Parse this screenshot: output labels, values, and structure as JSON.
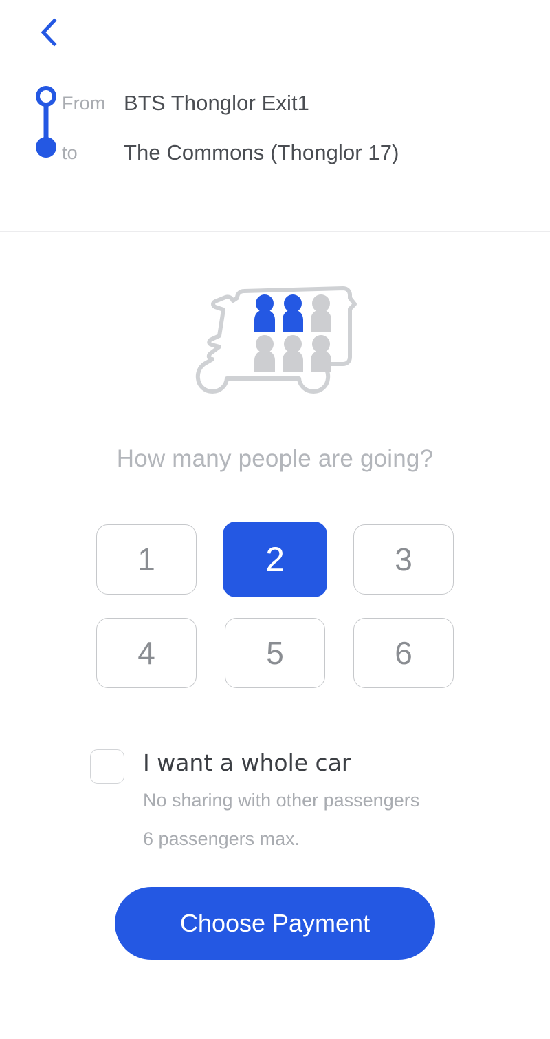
{
  "header": {
    "back_icon": "chevron-left-icon"
  },
  "route": {
    "from_label": "From",
    "from_value": "BTS Thonglor Exit1",
    "to_label": "to",
    "to_value": "The Commons (Thonglor 17)",
    "origin_icon": "circle-outline-icon",
    "destination_icon": "circle-filled-icon"
  },
  "illustration": {
    "name": "van-seating-icon",
    "total_seats": 6,
    "filled_seats": 2,
    "rows": 2,
    "columns": 3
  },
  "question": "How many people are going?",
  "numpad": {
    "selected": "2",
    "rows": [
      [
        "1",
        "2",
        "3"
      ],
      [
        "4",
        "5",
        "6"
      ]
    ]
  },
  "whole_car": {
    "checked": false,
    "title": "I want a whole car",
    "subtitle": "No sharing with other passengers",
    "subtitle2": "6 passengers max."
  },
  "cta": {
    "label": "Choose Payment"
  },
  "colors": {
    "accent": "#2458e3",
    "muted_text": "#a9acb1",
    "value_text": "#4a4d52",
    "border": "#c6c8cb",
    "seat_gray": "#cdced1"
  }
}
